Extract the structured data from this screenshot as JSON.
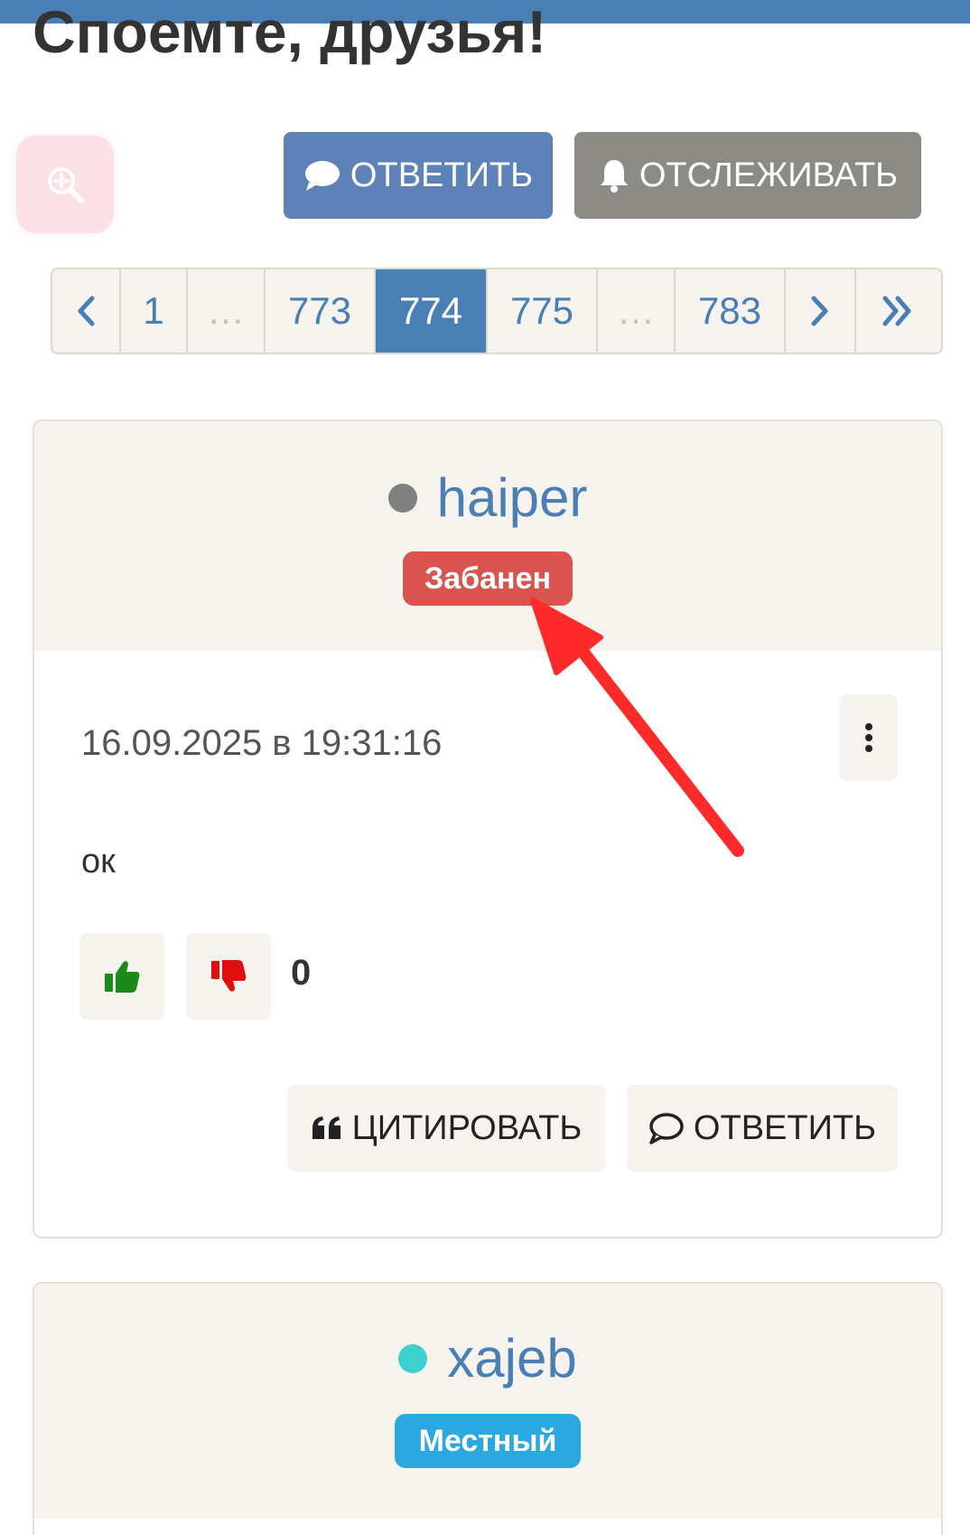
{
  "page": {
    "title": "Споемте, друзья!"
  },
  "toolbar": {
    "reply_label": "ОТВЕТИТЬ",
    "watch_label": "ОТСЛЕЖИВАТЬ",
    "zoom_icon": "zoom-in-icon"
  },
  "pagination": {
    "prev_icon": "chevron-left-icon",
    "items": [
      "1",
      "…",
      "773",
      "774",
      "775",
      "…",
      "783"
    ],
    "current": "774",
    "next_icon": "chevron-right-icon",
    "last_icon": "double-chevron-right-icon"
  },
  "posts": [
    {
      "username": "haiper",
      "status_color": "#808080",
      "badge": "Забанен",
      "badge_color": "#d9534f",
      "date": "16.09.2025 в 19:31:16",
      "text": "ок",
      "score": "0",
      "quote_label": "ЦИТИРОВАТЬ",
      "reply_label": "ОТВЕТИТЬ"
    },
    {
      "username": "xajeb",
      "status_color": "#3ecfcf",
      "badge": "Местный",
      "badge_color": "#2aa8e0"
    }
  ],
  "annotation": {
    "arrow_color": "#ff2a2a"
  },
  "colors": {
    "accent": "#4a7fb5",
    "reply_button": "#5d82b8",
    "watch_button": "#8c8a84",
    "panel_bg": "#f6f3ee",
    "vote_up": "#1a8a1a",
    "vote_down": "#e01010"
  }
}
